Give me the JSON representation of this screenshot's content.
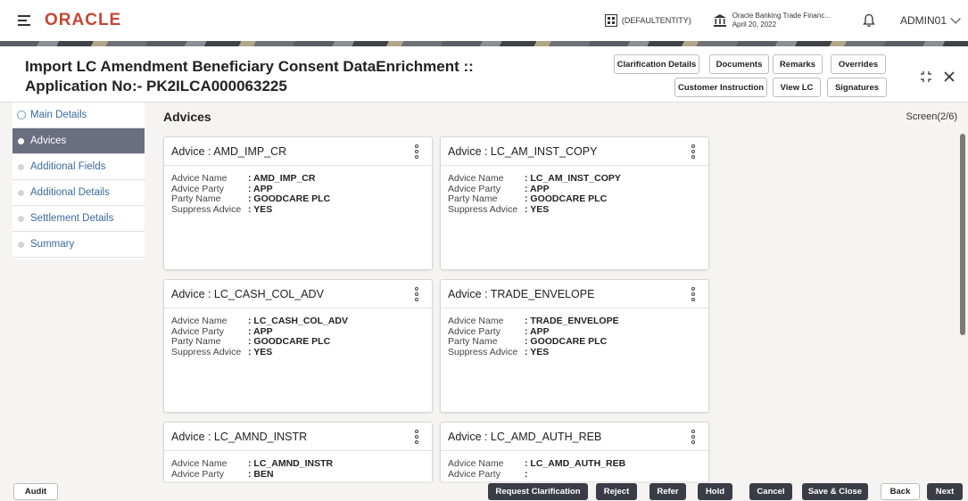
{
  "app": {
    "logo": "ORACLE",
    "entity": "(DEFAULTENTITY)",
    "bank_name": "Oracle Banking Trade Financ...",
    "bank_date": "April 20, 2022",
    "user": "ADMIN01"
  },
  "header": {
    "title_line1": "Import LC Amendment Beneficiary Consent DataEnrichment ::",
    "title_line2": "Application No:- PK2ILCA000063225",
    "buttons_row1": [
      "Clarification Details",
      "Documents",
      "Remarks",
      "Overrides"
    ],
    "buttons_row2": [
      "Customer Instruction",
      "View LC",
      "Signatures"
    ]
  },
  "sidebar": {
    "items": [
      {
        "label": "Main Details",
        "state": "done"
      },
      {
        "label": "Advices",
        "state": "active"
      },
      {
        "label": "Additional Fields",
        "state": "pending"
      },
      {
        "label": "Additional Details",
        "state": "pending"
      },
      {
        "label": "Settlement Details",
        "state": "pending"
      },
      {
        "label": "Summary",
        "state": "pending"
      }
    ]
  },
  "main": {
    "section_title": "Advices",
    "screen_no": "Screen(2/6)",
    "field_labels": {
      "advice_name": "Advice Name",
      "advice_party": "Advice Party",
      "party_name": "Party Name",
      "suppress_advice": "Suppress Advice"
    },
    "cards": [
      {
        "title": "Advice : AMD_IMP_CR",
        "advice_name": ": AMD_IMP_CR",
        "advice_party": ": APP",
        "party_name": ": GOODCARE PLC",
        "suppress_advice": ": YES"
      },
      {
        "title": "Advice : LC_AM_INST_COPY",
        "advice_name": ": LC_AM_INST_COPY",
        "advice_party": ": APP",
        "party_name": ": GOODCARE PLC",
        "suppress_advice": ": YES"
      },
      {
        "title": "Advice : LC_CASH_COL_ADV",
        "advice_name": ": LC_CASH_COL_ADV",
        "advice_party": ": APP",
        "party_name": ": GOODCARE PLC",
        "suppress_advice": ": YES"
      },
      {
        "title": "Advice : TRADE_ENVELOPE",
        "advice_name": ": TRADE_ENVELOPE",
        "advice_party": ": APP",
        "party_name": ": GOODCARE PLC",
        "suppress_advice": ": YES"
      },
      {
        "title": "Advice : LC_AMND_INSTR",
        "advice_name": ": LC_AMND_INSTR",
        "advice_party": ": BEN"
      },
      {
        "title": "Advice : LC_AMD_AUTH_REB",
        "advice_name": ": LC_AMD_AUTH_REB",
        "advice_party": ":"
      }
    ]
  },
  "footer": {
    "audit": "Audit",
    "request_clarification": "Request Clarification",
    "reject": "Reject",
    "refer": "Refer",
    "hold": "Hold",
    "cancel": "Cancel",
    "save_close": "Save & Close",
    "back": "Back",
    "next": "Next"
  }
}
